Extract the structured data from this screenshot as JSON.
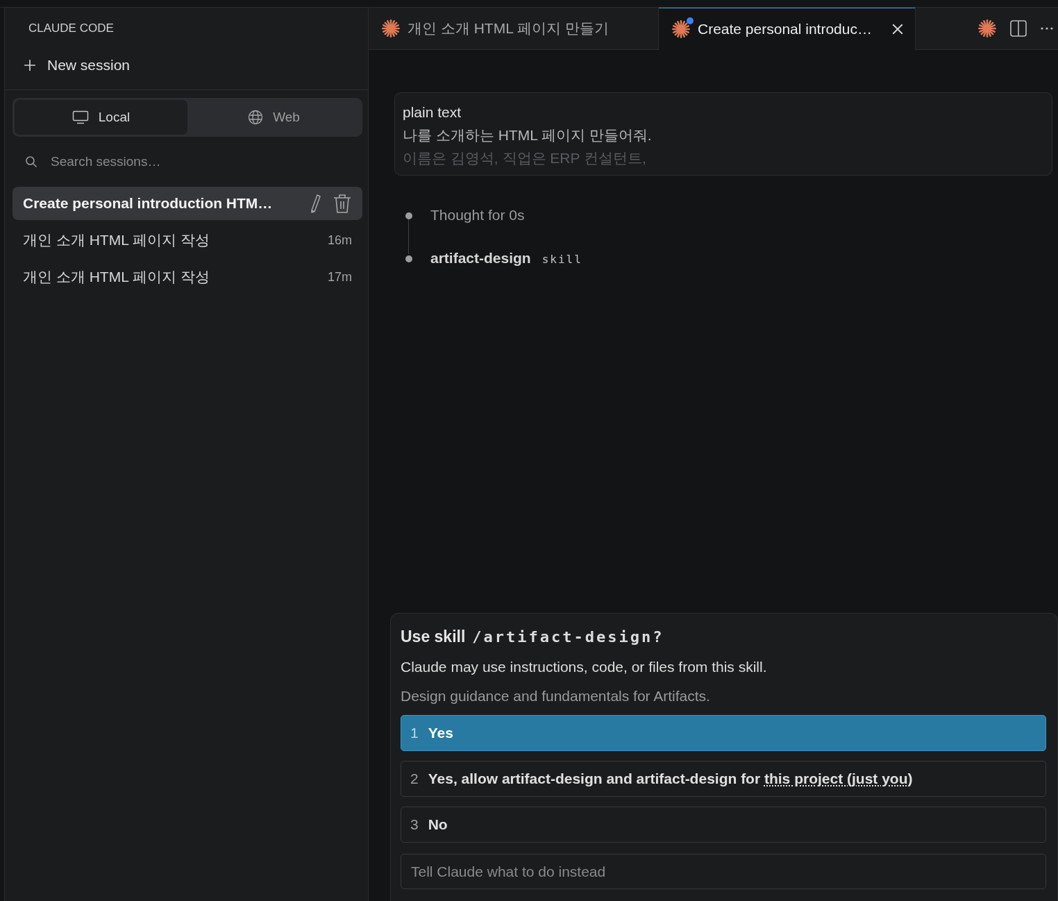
{
  "sidebar": {
    "title": "CLAUDE CODE",
    "new_session": "New session",
    "modes": [
      {
        "label": "Local",
        "kind": "local",
        "selected": true
      },
      {
        "label": "Web",
        "kind": "web",
        "selected": false
      }
    ],
    "search": {
      "placeholder": "Search sessions…"
    },
    "sessions": [
      {
        "title": "Create personal introduction HTM…",
        "selected": true
      },
      {
        "title": "개인 소개 HTML 페이지 작성",
        "time": "16m",
        "selected": false
      },
      {
        "title": "개인 소개 HTML 페이지 작성",
        "time": "17m",
        "selected": false
      }
    ]
  },
  "tabs": [
    {
      "label": "개인 소개 HTML 페이지 만들기",
      "selected": false,
      "indicator": false
    },
    {
      "label": "Create personal introduc…",
      "selected": true,
      "indicator": true
    }
  ],
  "message": {
    "lines": [
      "plain text",
      "나를 소개하는 HTML 페이지 만들어줘.",
      "이름은 김영석, 직업은 ERP 컨설턴트,"
    ]
  },
  "steps": [
    {
      "kind": "thought",
      "text": "Thought for 0s"
    },
    {
      "kind": "skill",
      "text": "artifact-design",
      "tag": "skill"
    }
  ],
  "prompt": {
    "title": "Use skill",
    "command": "/artifact-design?",
    "description": "Claude may use instructions, code, or files from this skill.",
    "detail": "Design guidance and fundamentals for Artifacts.",
    "options": [
      {
        "number": "1",
        "label": "Yes",
        "selected": true
      },
      {
        "number": "2",
        "label": "Yes, allow artifact-design and artifact-design for",
        "link": "this project (just you)",
        "selected": false
      },
      {
        "number": "3",
        "label": "No",
        "selected": false
      }
    ],
    "input": {
      "placeholder": "Tell Claude what to do instead"
    }
  }
}
